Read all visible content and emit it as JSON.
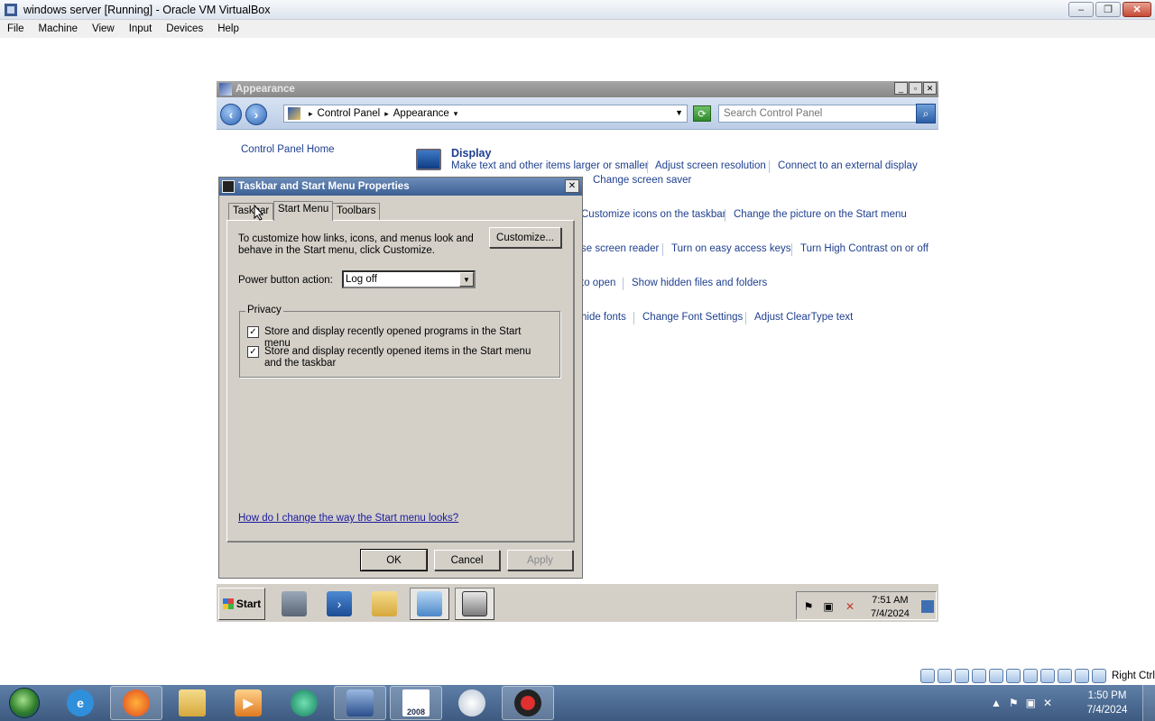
{
  "host": {
    "window_title": "windows server [Running] - Oracle VM VirtualBox",
    "controls": [
      "–",
      "❐",
      "✕"
    ],
    "menu": [
      "File",
      "Machine",
      "View",
      "Input",
      "Devices",
      "Help"
    ],
    "host_key": "Right Ctrl",
    "clock": {
      "time": "1:50 PM",
      "date": "7/4/2024"
    },
    "taskbar_apps": [
      "internet-explorer",
      "firefox",
      "file-explorer",
      "media-player",
      "app-green-circle",
      "virtualbox",
      "sql-server-2008",
      "disc-app",
      "obs-recorder"
    ],
    "sql_badge": "2008"
  },
  "control_panel": {
    "title": "Appearance",
    "breadcrumb": [
      "Control Panel",
      "Appearance"
    ],
    "search_placeholder": "Search Control Panel",
    "home_link": "Control Panel Home",
    "category_title": "Display",
    "links": {
      "display_1": "Make text and other items larger or smaller",
      "display_2": "Adjust screen resolution",
      "display_3": "Connect to an external display",
      "screen_saver": "Change screen saver",
      "taskbar_1": "Customize icons on the taskbar",
      "taskbar_2": "Change the picture on the Start menu",
      "ease_1": "se screen reader",
      "ease_2": "Turn on easy access keys",
      "ease_3": "Turn High Contrast on or off",
      "folder_1": "to open",
      "folder_2": "Show hidden files and folders",
      "fonts_1": "hide fonts",
      "fonts_2": "Change Font Settings",
      "fonts_3": "Adjust ClearType text"
    }
  },
  "dialog": {
    "title": "Taskbar and Start Menu Properties",
    "close": "✕",
    "tabs": [
      "Taskbar",
      "Start Menu",
      "Toolbars"
    ],
    "active_tab": "Start Menu",
    "description": "To customize how links, icons, and menus look and behave in the Start menu, click Customize.",
    "customize_button": "Customize...",
    "power_label": "Power button action:",
    "power_value": "Log off",
    "privacy_label": "Privacy",
    "checkbox_1": {
      "label": "Store and display recently opened programs in the Start menu",
      "checked": true,
      "mark": "✓"
    },
    "checkbox_2": {
      "label": "Store and display recently opened items in the Start menu and the taskbar",
      "checked": true,
      "mark": "✓"
    },
    "help_link": "How do I change the way the Start menu looks?",
    "ok": "OK",
    "cancel": "Cancel",
    "apply": "Apply"
  },
  "guest_taskbar": {
    "start": "Start",
    "apps": [
      "server-manager",
      "powershell",
      "explorer-folder",
      "control-panel",
      "taskbar-properties"
    ],
    "clock": {
      "time": "7:51 AM",
      "date": "7/4/2024"
    }
  },
  "colors": {
    "link": "#1e3f8f",
    "dialog_title": "#3b5f94",
    "host_taskbar": "#4a6a93"
  }
}
